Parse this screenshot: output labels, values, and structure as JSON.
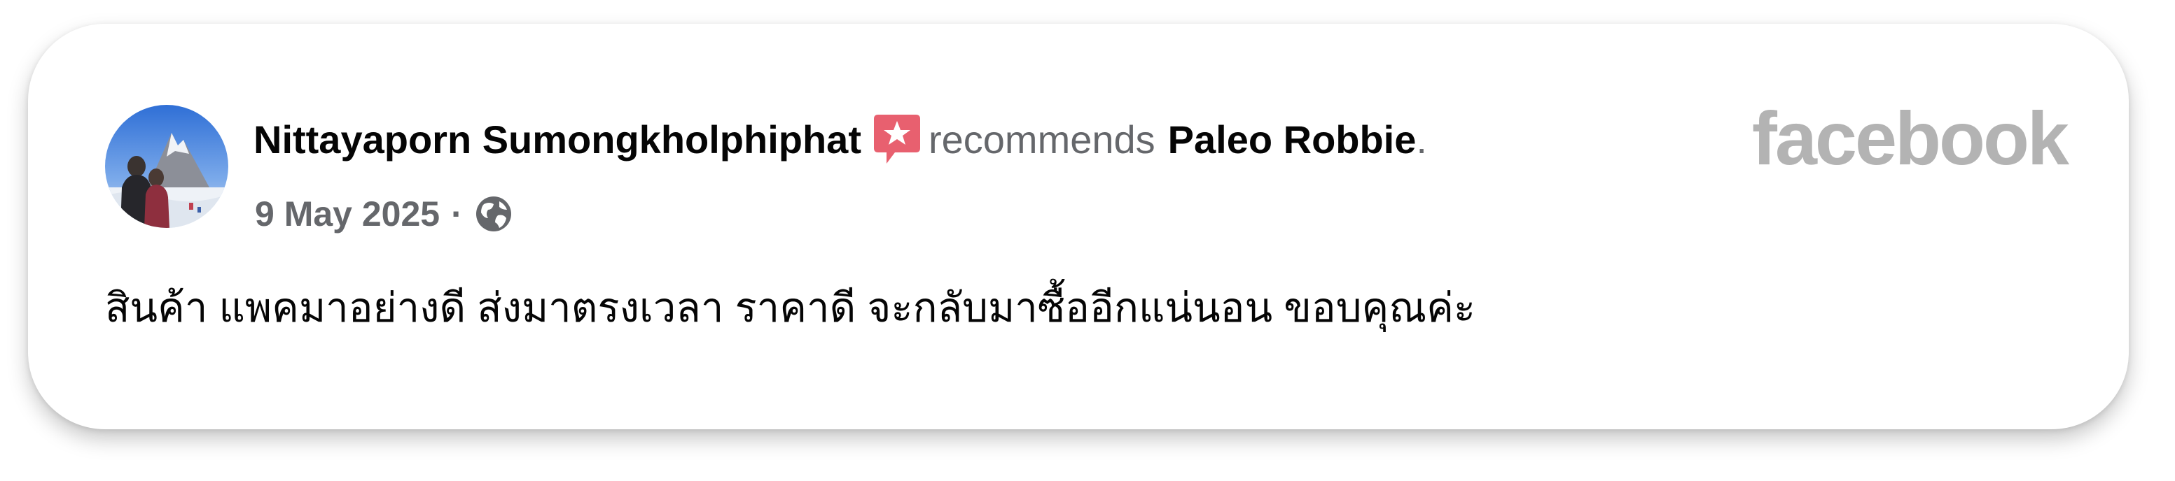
{
  "post": {
    "author": "Nittayaporn Sumongkholphiphat",
    "action": "recommends",
    "page_name": "Paleo Robbie",
    "period": ".",
    "date": "9 May 2025",
    "separator": "·",
    "review_text": "สินค้า แพคมาอย่างดี ส่งมาตรงเวลา ราคาดี จะกลับมาซื้ออีกแน่นอน ขอบคุณค่ะ"
  },
  "brand": {
    "logo_text": "facebook"
  },
  "icons": {
    "recommend": "recommend-star-speech-bubble-icon",
    "audience": "globe-icon"
  },
  "colors": {
    "recommend_red": "#e8606f",
    "secondary_text": "#65676b",
    "brand_gray": "#b3b3b3",
    "primary_text": "#050505"
  }
}
